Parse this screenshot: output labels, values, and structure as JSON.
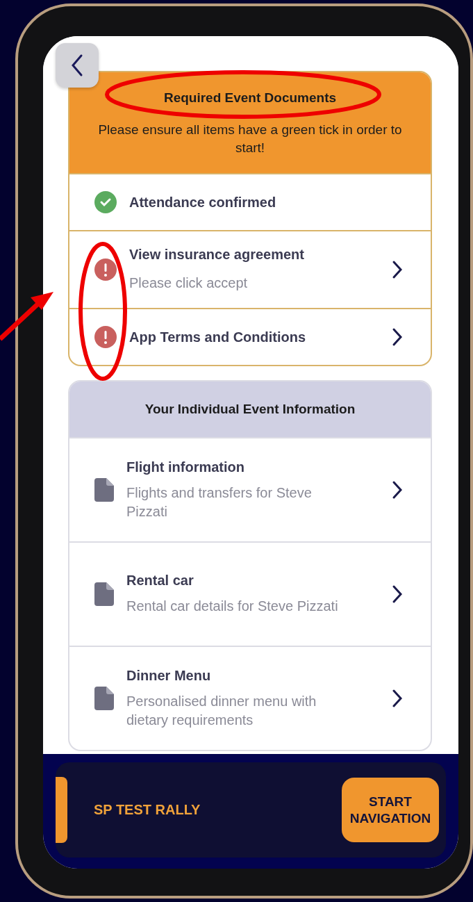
{
  "required_documents": {
    "title": "Required Event Documents",
    "subtitle": "Please ensure all items have a green tick in order to start!",
    "items": [
      {
        "label": "Attendance confirmed",
        "complete": true,
        "linked": false
      },
      {
        "label": "View insurance agreement",
        "note": "Please click accept",
        "complete": false,
        "linked": true
      },
      {
        "label": "App Terms and Conditions",
        "complete": false,
        "linked": true
      }
    ]
  },
  "event_information": {
    "title": "Your Individual Event Information",
    "items": [
      {
        "title": "Flight information",
        "description": "Flights and transfers for Steve Pizzati"
      },
      {
        "title": "Rental car",
        "description": "Rental car details for Steve Pizzati"
      },
      {
        "title": "Dinner Menu",
        "description": "Personalised dinner menu with dietary requirements"
      }
    ]
  },
  "footer": {
    "event_name": "SP TEST RALLY",
    "button": "START NAVIGATION"
  }
}
